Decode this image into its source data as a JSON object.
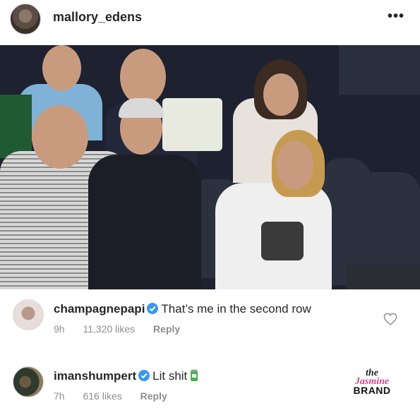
{
  "post": {
    "username": "mallory_edens",
    "more_icon": "more-dots-icon"
  },
  "comments": [
    {
      "username": "champagnepapi",
      "text": "That’s me in the second row",
      "time": "9h",
      "likes": "11,320 likes",
      "reply": "Reply"
    },
    {
      "username": "imanshumpert",
      "text": "Lit shit",
      "time": "7h",
      "likes": "616 likes",
      "reply": "Reply"
    }
  ],
  "watermark": {
    "line1": "the",
    "line2": "Jasmine",
    "line3": "BRAND"
  },
  "colors": {
    "verified_blue": "#3897f0",
    "meta_gray": "#8e8e8e",
    "watermark_pink": "#e2418b"
  }
}
